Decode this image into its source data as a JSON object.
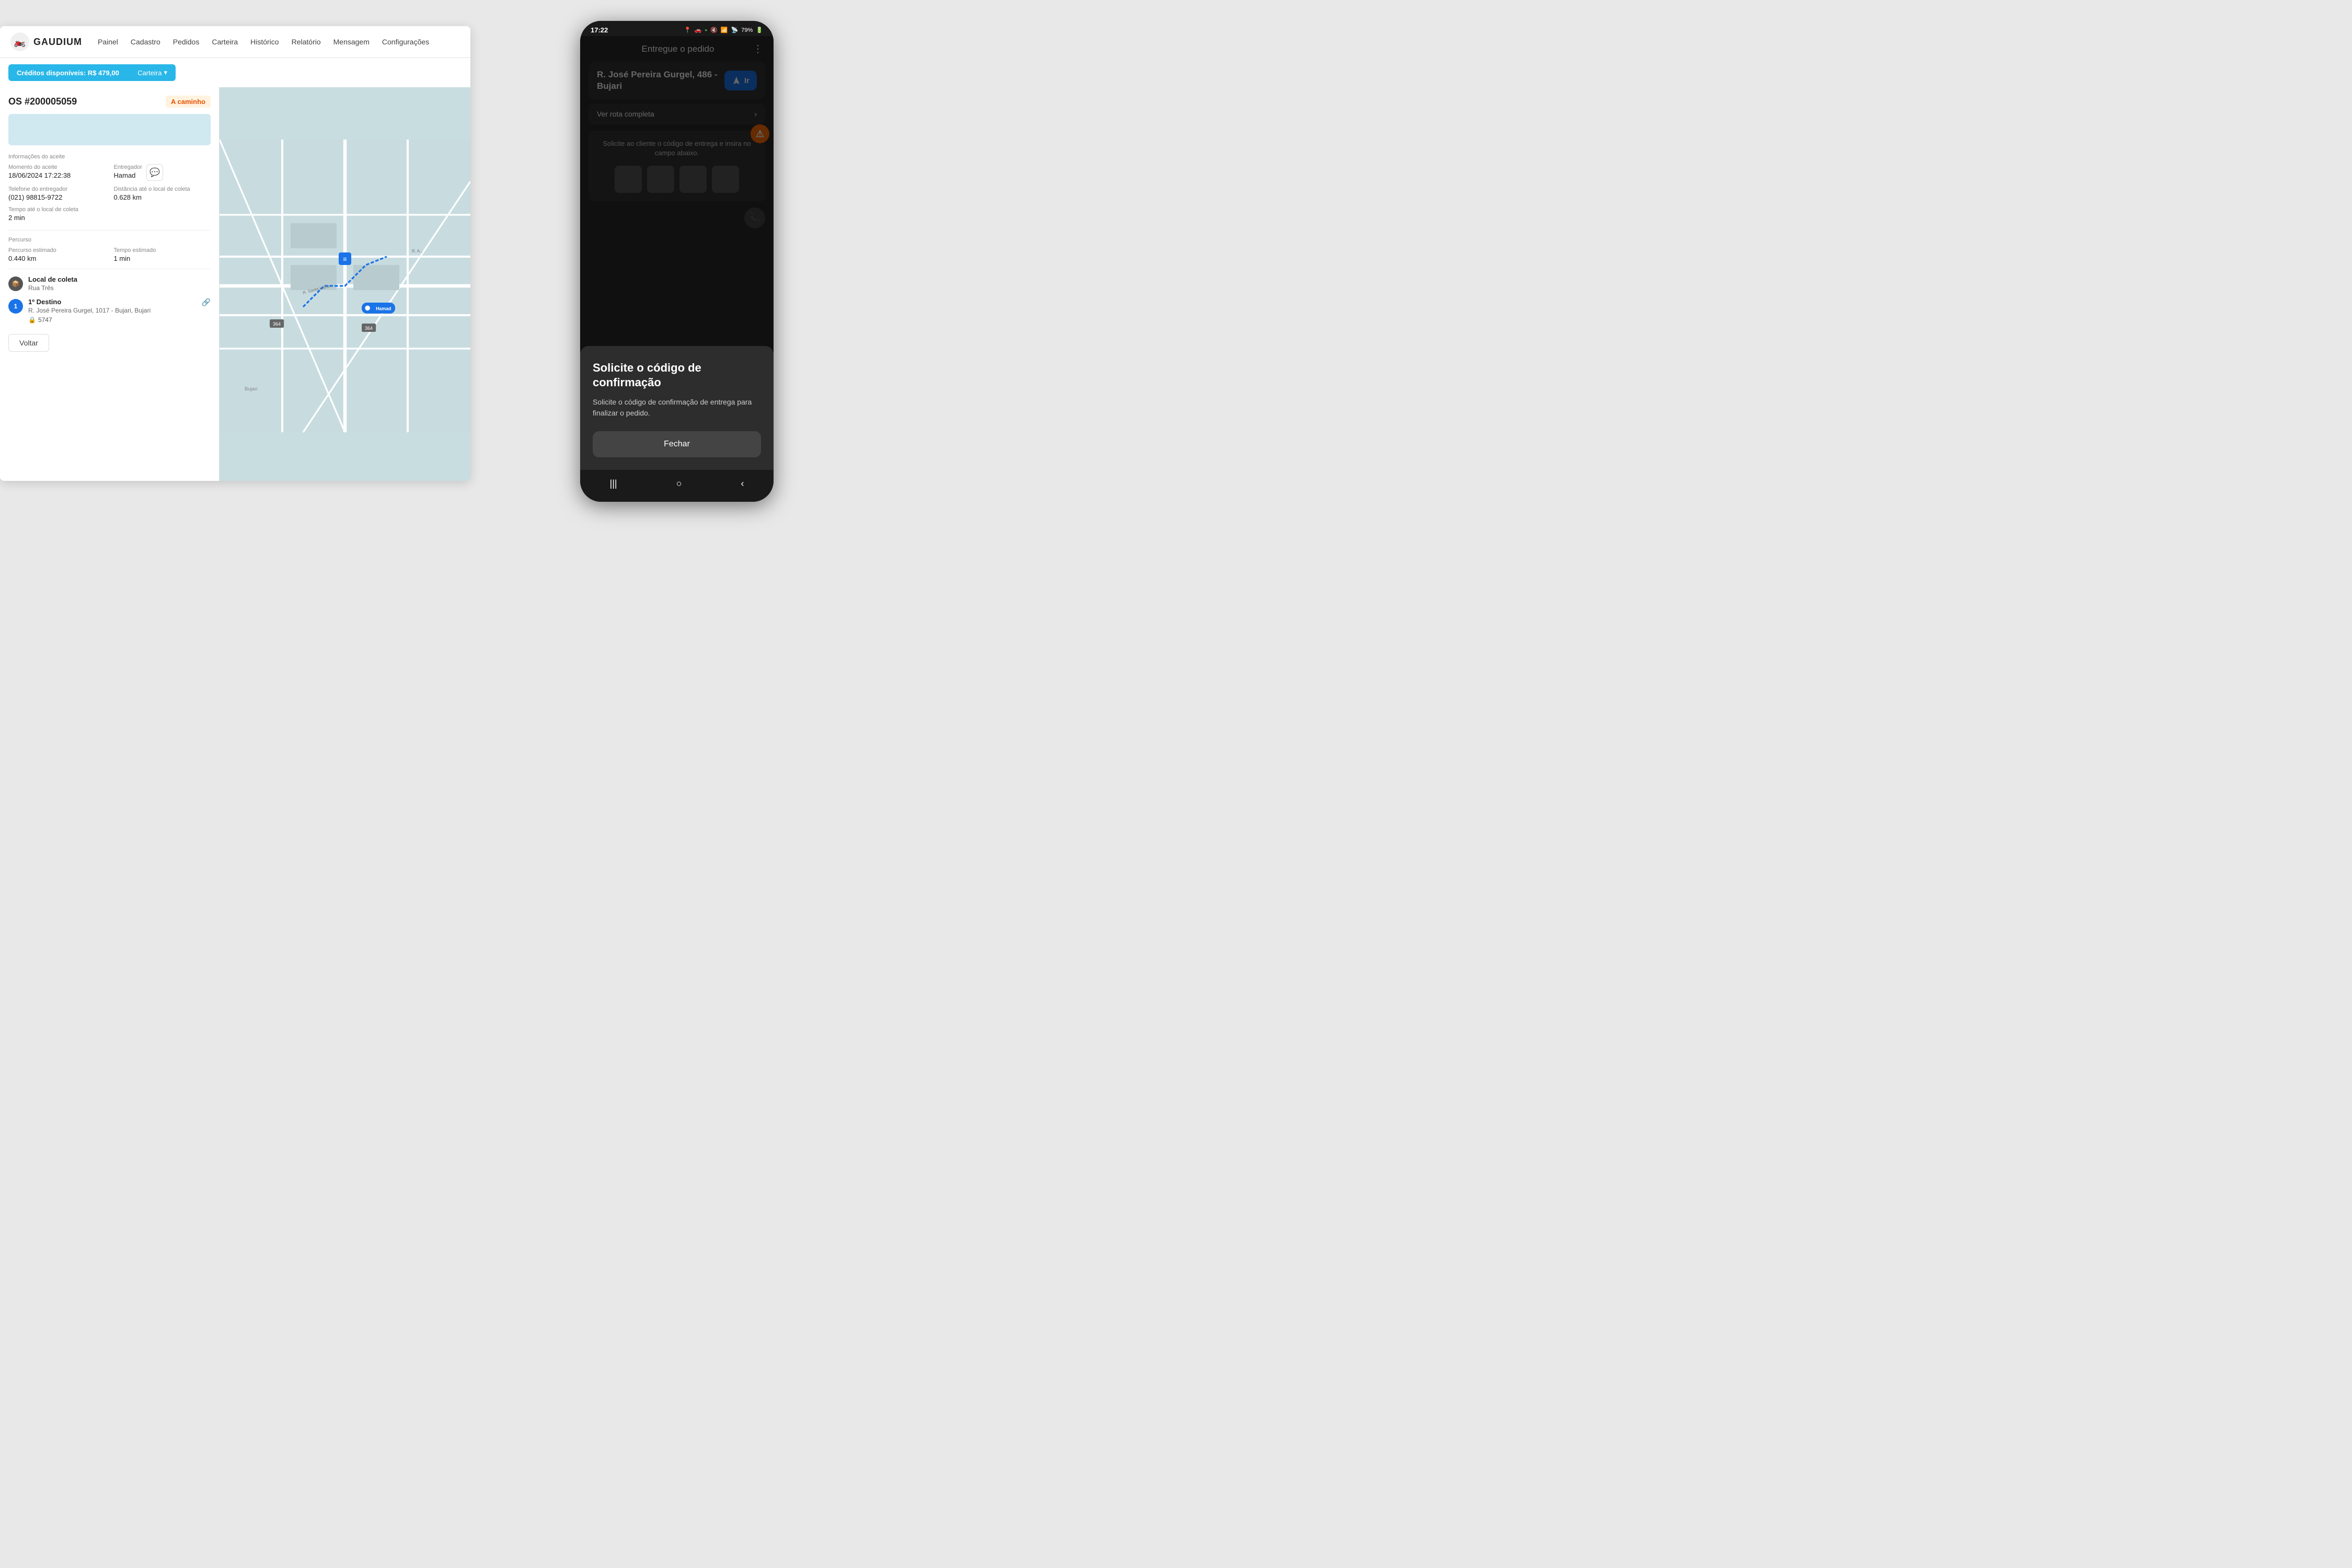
{
  "desktop": {
    "logo": {
      "text": "GAUDIUM",
      "icon": "🏍️"
    },
    "nav": {
      "items": [
        "Painel",
        "Cadastro",
        "Pedidos",
        "Carteira",
        "Histórico",
        "Relatório",
        "Mensagem",
        "Configurações"
      ]
    },
    "credits_bar": {
      "label": "Créditos disponíveis: R$ 479,00",
      "button_label": "Carteira",
      "chevron": "▾"
    },
    "order": {
      "number": "OS #200005059",
      "status": "A caminho",
      "acceptance_section": "Informações do aceite",
      "fields": {
        "momento_label": "Momento do aceite",
        "momento_value": "18/06/2024 17:22:38",
        "entregador_label": "Entregador",
        "entregador_value": "Hamad",
        "telefone_label": "Telefone do entregador",
        "telefone_value": "(021) 98815-9722",
        "distancia_label": "Distância até o local de coleta",
        "distancia_value": "0.628 km",
        "tempo_label": "Tempo até o local de coleta",
        "tempo_value": "2 min"
      },
      "route_section": "Percurso",
      "route": {
        "percurso_label": "Percurso estimado",
        "percurso_value": "0.440 km",
        "tempo_label": "Tempo estimado",
        "tempo_value": "1 min"
      },
      "stops": [
        {
          "type": "coleta",
          "title": "Local de coleta",
          "address": "Rua Três",
          "icon": "📦"
        },
        {
          "type": "destino",
          "number": "1",
          "title": "1º Destino",
          "address": "R. José Pereira Gurgel, 1017 - Bujari, Bujari",
          "code": "🔒 5747"
        }
      ],
      "back_button": "Voltar"
    },
    "map_marker": "Hamad"
  },
  "phone": {
    "status_bar": {
      "time": "17:22",
      "battery": "79%",
      "signal": "📶"
    },
    "top_bar": {
      "title": "Entregue o pedido",
      "menu_icon": "⋮"
    },
    "delivery_address": "R. José Pereira Gurgel, 486 - Bujari",
    "navigate_button": "Ir",
    "route_link": "Ver rota completa",
    "code_section": {
      "instruction": "Solicite ao cliente o código de entrega e insira no campo abaixo.",
      "warning_icon": "⚠"
    },
    "modal": {
      "title": "Solicite o código de confirmação",
      "body": "Solicite o código de confirmação de entrega para finalizar o pedido.",
      "close_button": "Fechar"
    },
    "bottom_nav": {
      "items": [
        "|||",
        "○",
        "‹"
      ]
    }
  }
}
